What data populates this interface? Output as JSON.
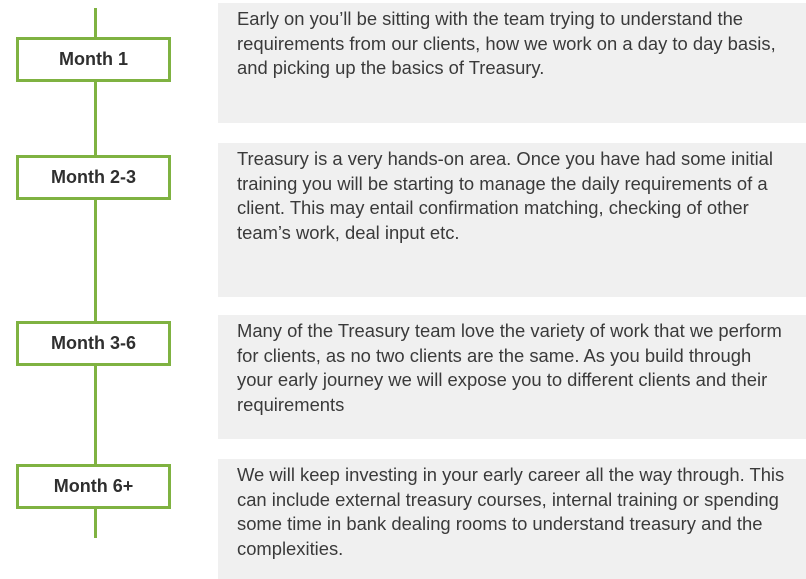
{
  "timeline": [
    {
      "month": "Month 1",
      "description": "Early on you’ll be sitting with the team trying to understand the requirements from our clients, how we work on a day to day basis, and picking up the basics of Treasury."
    },
    {
      "month": "Month 2-3",
      "description": "Treasury is a very hands-on area. Once you have had some initial training you will be starting to manage the daily requirements of a client. This may entail confirmation matching, checking of other team’s work, deal input etc."
    },
    {
      "month": "Month 3-6",
      "description": "Many of the Treasury team love the variety of work that we perform for clients, as no two clients are the same. As you build through your early journey we will expose you to different clients and their requirements"
    },
    {
      "month": "Month 6+",
      "description": "We will keep investing in your early career all the way through. This can include external treasury courses, internal training or spending some time in bank dealing rooms to understand treasury and the complexities."
    }
  ]
}
